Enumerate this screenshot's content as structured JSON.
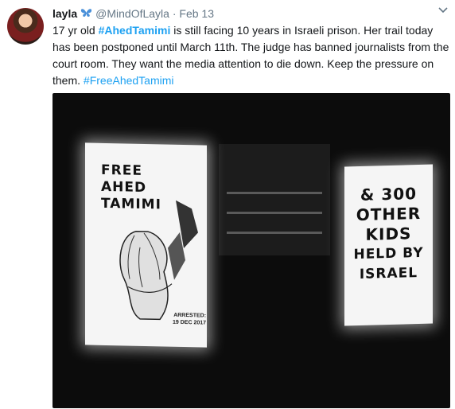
{
  "tweet": {
    "name": "layla",
    "badge_icon": "butterfly-icon",
    "handle": "@MindOfLayla",
    "separator": "·",
    "date": "Feb 13",
    "text_parts": {
      "p1": "17 yr old ",
      "hashtag1": "#AhedTamimi",
      "p2": " is still facing 10 years in Israeli prison. Her trail today has been postponed until March 11th. The judge has banned journalists from the court room. They want the media attention to die down. Keep the pressure on them. ",
      "hashtag2": "#FreeAhedTamimi"
    }
  },
  "media": {
    "poster_left": {
      "line1": "FREE",
      "line2": "AHED",
      "line3": "TAMIMI",
      "arrested_line1": "ARRESTED:",
      "arrested_line2": "19 DEC 2017"
    },
    "poster_right": {
      "line1": "& 300",
      "line2": "OTHER",
      "line3": "KIDS",
      "line4": "HELD BY",
      "line5": "ISRAEL"
    }
  },
  "colors": {
    "link": "#1da1f2",
    "muted": "#657786",
    "text": "#14171a"
  }
}
